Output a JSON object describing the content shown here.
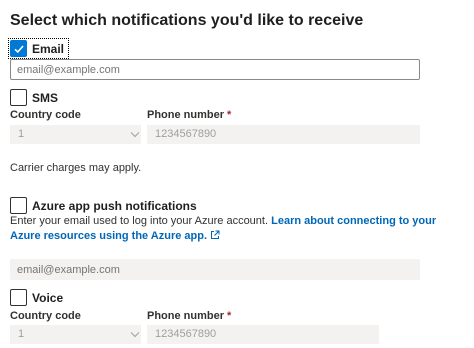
{
  "title": "Select which notifications you'd like to receive",
  "email": {
    "label": "Email",
    "checked": true,
    "placeholder": "email@example.com"
  },
  "sms": {
    "label": "SMS",
    "checked": false,
    "country_code_label": "Country code",
    "country_code_value": "1",
    "phone_label": "Phone number",
    "required_marker": "*",
    "phone_value": "1234567890",
    "carrier_note": "Carrier charges may apply."
  },
  "azure_push": {
    "label": "Azure app push notifications",
    "checked": false,
    "description": "Enter your email used to log into your Azure account.",
    "link_text": "Learn about connecting to your Azure resources using the Azure app.",
    "email_placeholder": "email@example.com"
  },
  "voice": {
    "label": "Voice",
    "checked": false,
    "country_code_label": "Country code",
    "country_code_value": "1",
    "phone_label": "Phone number",
    "required_marker": "*",
    "phone_value": "1234567890"
  },
  "colors": {
    "accent": "#0078d4",
    "link": "#0067b8",
    "required": "#a4262c",
    "disabled_bg": "#f3f2f1"
  }
}
